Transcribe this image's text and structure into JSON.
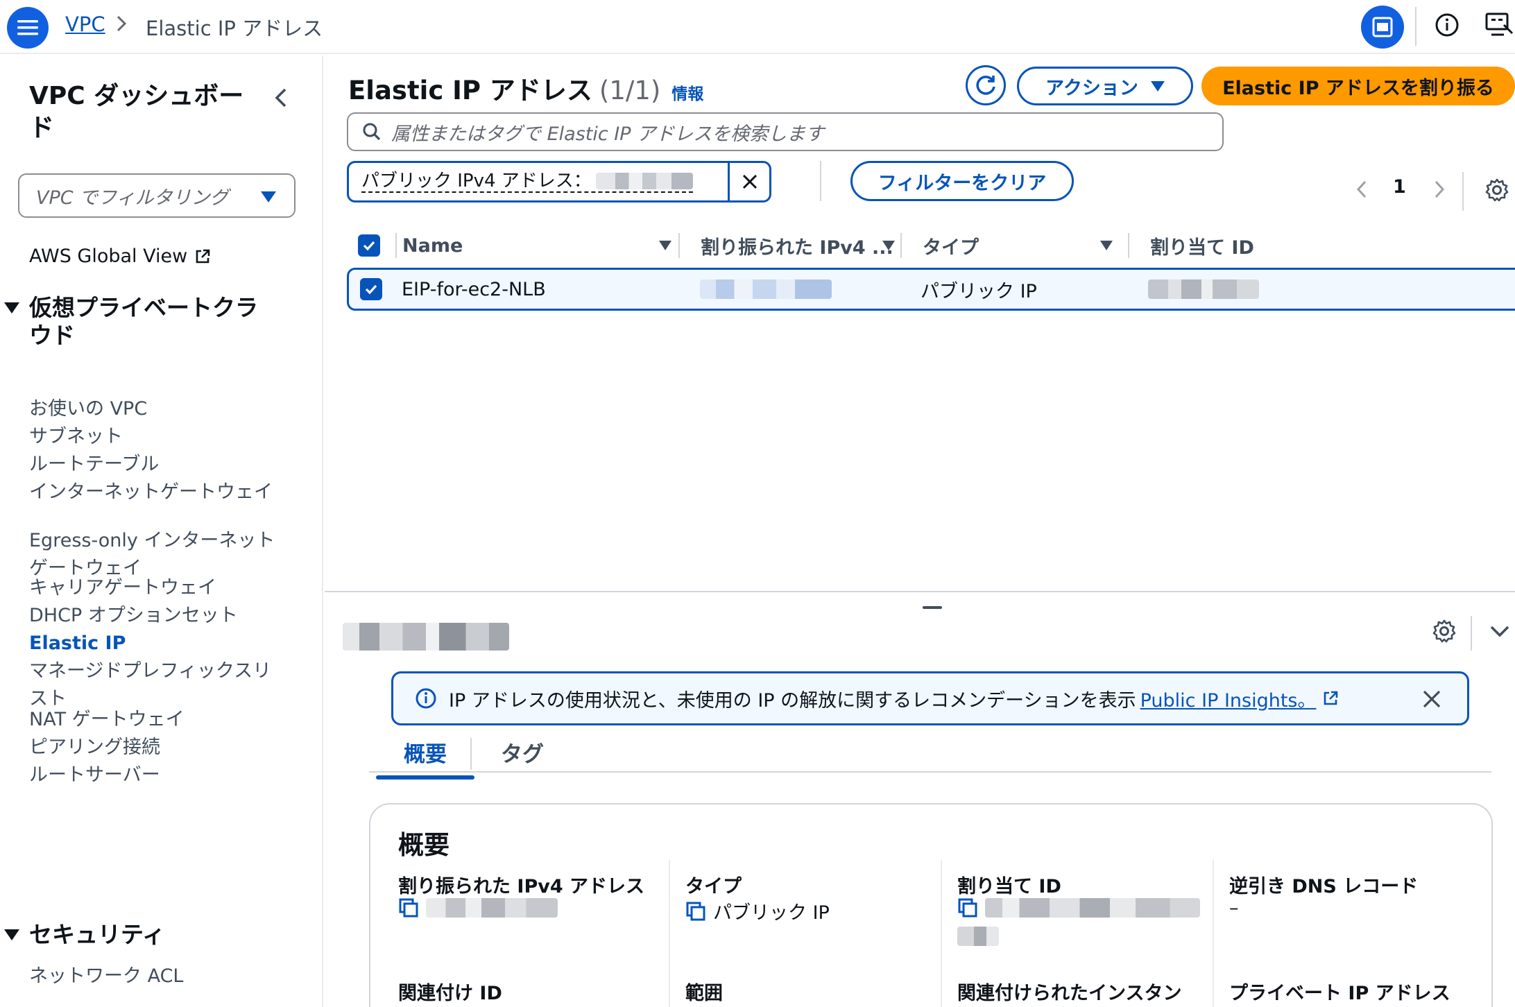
{
  "breadcrumb": {
    "root": "VPC",
    "current": "Elastic IP アドレス"
  },
  "sidebar": {
    "title": "VPC ダッシュボード",
    "filter_placeholder": "VPC でフィルタリング",
    "global_view": "AWS Global View",
    "sections": [
      {
        "label": "仮想プライベートクラウド",
        "items": [
          "お使いの VPC",
          "サブネット",
          "ルートテーブル",
          "インターネットゲートウェイ",
          "Egress-only インターネットゲートウェイ",
          "キャリアゲートウェイ",
          "DHCP オプションセット",
          "Elastic IP",
          "マネージドプレフィックスリスト",
          "NAT ゲートウェイ",
          "ピアリング接続",
          "ルートサーバー"
        ],
        "active": "Elastic IP"
      },
      {
        "label": "セキュリティ",
        "items": [
          "ネットワーク ACL"
        ]
      }
    ]
  },
  "main": {
    "title": "Elastic IP アドレス",
    "count": "(1/1)",
    "info_link": "情報",
    "actions_label": "アクション",
    "allocate_label": "Elastic IP アドレスを割り振る",
    "search_placeholder": "属性またはタグで Elastic IP アドレスを検索します",
    "filter_token_label": "パブリック IPv4 アドレス：",
    "clear_filter_label": "フィルターをクリア",
    "page_number": "1",
    "columns": [
      "Name",
      "割り振られた IPv4 ...",
      "タイプ",
      "割り当て ID"
    ],
    "rows": [
      {
        "name": "EIP-for-ec2-NLB",
        "type": "パブリック IP",
        "selected": true
      }
    ]
  },
  "detail": {
    "notice_text": "IP アドレスの使用状況と、未使用の IP の解放に関するレコメンデーションを表示",
    "notice_link": "Public IP Insights。",
    "tabs": [
      "概要",
      "タグ"
    ],
    "active_tab": "概要",
    "card_title": "概要",
    "fields": [
      {
        "label": "割り振られた IPv4 アドレス"
      },
      {
        "label": "タイプ",
        "value": "パブリック IP"
      },
      {
        "label": "割り当て ID"
      },
      {
        "label": "逆引き DNS レコード",
        "value": "–"
      },
      {
        "label": "関連付け ID"
      },
      {
        "label": "範囲"
      },
      {
        "label": "関連付けられたインスタン"
      },
      {
        "label": "プライベート IP アドレス"
      }
    ]
  },
  "colors": {
    "primary": "#0654b9",
    "accent": "#ff9900",
    "text": "#0f141a",
    "muted": "#414d5c"
  }
}
